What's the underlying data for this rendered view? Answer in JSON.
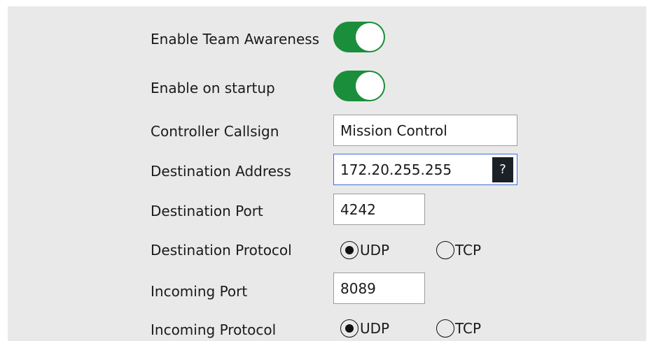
{
  "settings": {
    "team_awareness": {
      "label": "Enable Team Awareness",
      "enabled": true
    },
    "startup": {
      "label": "Enable on startup",
      "enabled": true
    },
    "callsign": {
      "label": "Controller Callsign",
      "value": "Mission Control"
    },
    "destination_address": {
      "label": "Destination Address",
      "value": "172.20.255.255",
      "help": "?"
    },
    "destination_port": {
      "label": "Destination Port",
      "value": "4242"
    },
    "destination_protocol": {
      "label": "Destination Protocol",
      "options": [
        "UDP",
        "TCP"
      ],
      "selected": "UDP"
    },
    "incoming_port": {
      "label": "Incoming Port",
      "value": "8089"
    },
    "incoming_protocol": {
      "label": "Incoming Protocol",
      "options": [
        "UDP",
        "TCP"
      ],
      "selected": "UDP"
    }
  },
  "colors": {
    "panel_bg": "#e9e9e9",
    "toggle_on": "#1a8e3a",
    "focus_border": "#3f6fd8",
    "help_button_bg": "#1c2128"
  },
  "icons": {
    "help": "question-mark-icon",
    "toggle_knob": "toggle-knob"
  }
}
